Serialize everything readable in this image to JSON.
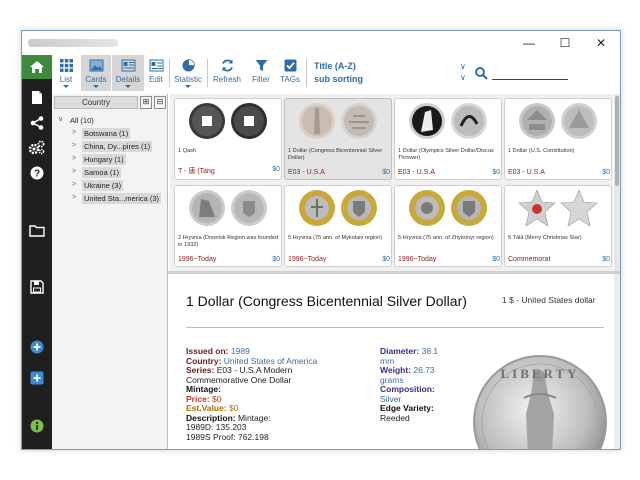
{
  "window": {
    "controls": {
      "minimize": "—",
      "maximize": "☐",
      "close": "✕"
    }
  },
  "toolbar": {
    "buttons": [
      {
        "id": "list",
        "label": "List",
        "icon": "grid-icon"
      },
      {
        "id": "cards",
        "label": "Cards",
        "icon": "image-icon"
      },
      {
        "id": "details",
        "label": "Details",
        "icon": "details-icon"
      },
      {
        "id": "edit",
        "label": "Edit",
        "icon": "edit-icon"
      },
      {
        "id": "statistic",
        "label": "Statistic",
        "icon": "pie-chart-icon"
      },
      {
        "id": "refresh",
        "label": "Refresh",
        "icon": "refresh-icon"
      },
      {
        "id": "filter",
        "label": "Filter",
        "icon": "filter-icon"
      },
      {
        "id": "tags",
        "label": "TAGs",
        "icon": "checkbox-icon"
      }
    ],
    "sort_title": "Title (A-Z)",
    "sort_sub": "sub sorting",
    "search_value": ""
  },
  "sidebar_icons": [
    "home-icon",
    "document-icon",
    "share-icon",
    "settings-icon",
    "help-icon",
    "folder-icon",
    "save-icon",
    "add-circle-icon",
    "add-square-icon",
    "info-icon"
  ],
  "country_panel": {
    "header": "Country",
    "expand_btn": "⊞",
    "collapse_btn": "⊟",
    "items": [
      {
        "label": "All (10)",
        "level": 0,
        "arrow": "∨"
      },
      {
        "label": "Botswana (1)",
        "level": 1,
        "arrow": ">"
      },
      {
        "label": "China, Dy...pires (1)",
        "level": 1,
        "arrow": ">"
      },
      {
        "label": "Hungary (1)",
        "level": 1,
        "arrow": ">"
      },
      {
        "label": "Samoa (1)",
        "level": 1,
        "arrow": ">"
      },
      {
        "label": "Ukraine (3)",
        "level": 1,
        "arrow": ">"
      },
      {
        "label": "United Sta...merica (3)",
        "level": 1,
        "arrow": ">"
      }
    ]
  },
  "cards": [
    {
      "name": "1 Qash",
      "period": "T - 唐 (Tang",
      "price": "$0",
      "style": "square-hole"
    },
    {
      "name": "1 Dollar (Congress Bicentennial Silver Dollar)",
      "period": "E03 - U.S.A",
      "price": "$0",
      "style": "silver",
      "selected": true
    },
    {
      "name": "1 Dollar (Olympics Silver Dollar/Discus Thrower)",
      "period": "E03 - U.S.A",
      "price": "$0",
      "style": "silver-dark"
    },
    {
      "name": "1 Dollar (U.S. Constitution)",
      "period": "E03 - U.S.A",
      "price": "$0",
      "style": "silver"
    },
    {
      "name": "2 Hryvnia (Donetsk Region was founded in 1932)",
      "period": "1996~Today",
      "price": "$0",
      "style": "silver"
    },
    {
      "name": "5 Hryvnia (75 ann. of Mykolaiv region)",
      "period": "1996~Today",
      "price": "$0",
      "style": "bimetal"
    },
    {
      "name": "5 Hryvnia (75 ann. of Zhytomyr region)",
      "period": "1996~Today",
      "price": "$0",
      "style": "bimetal"
    },
    {
      "name": "5 Tālā (Merry Christmas Star)",
      "period": "Commemorat",
      "price": "$0",
      "style": "star"
    }
  ],
  "detail": {
    "title": "1 Dollar (Congress Bicentennial Silver Dollar)",
    "subtitle": "1 $ - United States dollar",
    "left": [
      {
        "key": "Issued on:",
        "value": "1989"
      },
      {
        "key": "Country:",
        "value": "United States of America"
      },
      {
        "key": "Series:",
        "value": "E03 - U.S.A Modern"
      },
      {
        "key": "",
        "value": "Commemorative One Dollar"
      },
      {
        "key": "Mintage:",
        "value": ""
      },
      {
        "key": "Price:",
        "value": "$0"
      },
      {
        "key": "Est.Value:",
        "value": "$0"
      },
      {
        "key": "Description:",
        "value": "Mintage:"
      },
      {
        "key": "",
        "value": "1989D: 135.203"
      },
      {
        "key": "",
        "value": "1989S Proof: 762.198"
      }
    ],
    "right": [
      {
        "key": "Diameter:",
        "value": "38.1"
      },
      {
        "key": "",
        "value": "mm"
      },
      {
        "key": "Weight:",
        "value": "26.73"
      },
      {
        "key": "",
        "value": "grams"
      },
      {
        "key": "Composition:",
        "value": ""
      },
      {
        "key": "",
        "value": "Silver"
      },
      {
        "key": "Edge Variety:",
        "value": ""
      },
      {
        "key": "",
        "value": "Reeded"
      }
    ],
    "coin_legend": "LIBERTY"
  },
  "colors": {
    "accent": "#2f6da8",
    "home": "#3e8a3c",
    "sidebar": "#1f1f1f",
    "period": "#8b1a1a"
  }
}
